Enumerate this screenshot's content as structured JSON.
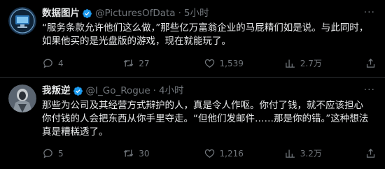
{
  "tweets": [
    {
      "name": "数据图片",
      "handle": "@PicturesOfData",
      "time": "5小时",
      "text": "“服务条款允许他们这么做，”那些亿万富翁企业的马屁精们如是说。与此同时，\n如果他买的是光盘版的游戏，现在就能玩了。",
      "replies": "4",
      "retweets": "27",
      "likes": "1,539",
      "views": "2.7万"
    },
    {
      "name": "我叛逆",
      "handle": "@I_Go_Rogue",
      "time": "4小时",
      "text": "那些为公司及其经营方式辩护的人，真是令人作呕。你付了钱，就不应该担心\n你付钱的人会把东西从你手里夺走。“但他们发邮件……那是你的错。”这种想法\n真是糟糕透了。",
      "replies": "5",
      "retweets": "30",
      "likes": "1,216",
      "views": "3.2万"
    }
  ],
  "colors": {
    "background": "#000000",
    "text": "#e7e9ea",
    "muted": "#71767b",
    "verified": "#1d9bf0",
    "divider": "#2f3336"
  },
  "icons": [
    "verified-badge-icon",
    "more-icon",
    "reply-icon",
    "retweet-icon",
    "like-icon",
    "views-icon",
    "share-icon"
  ]
}
